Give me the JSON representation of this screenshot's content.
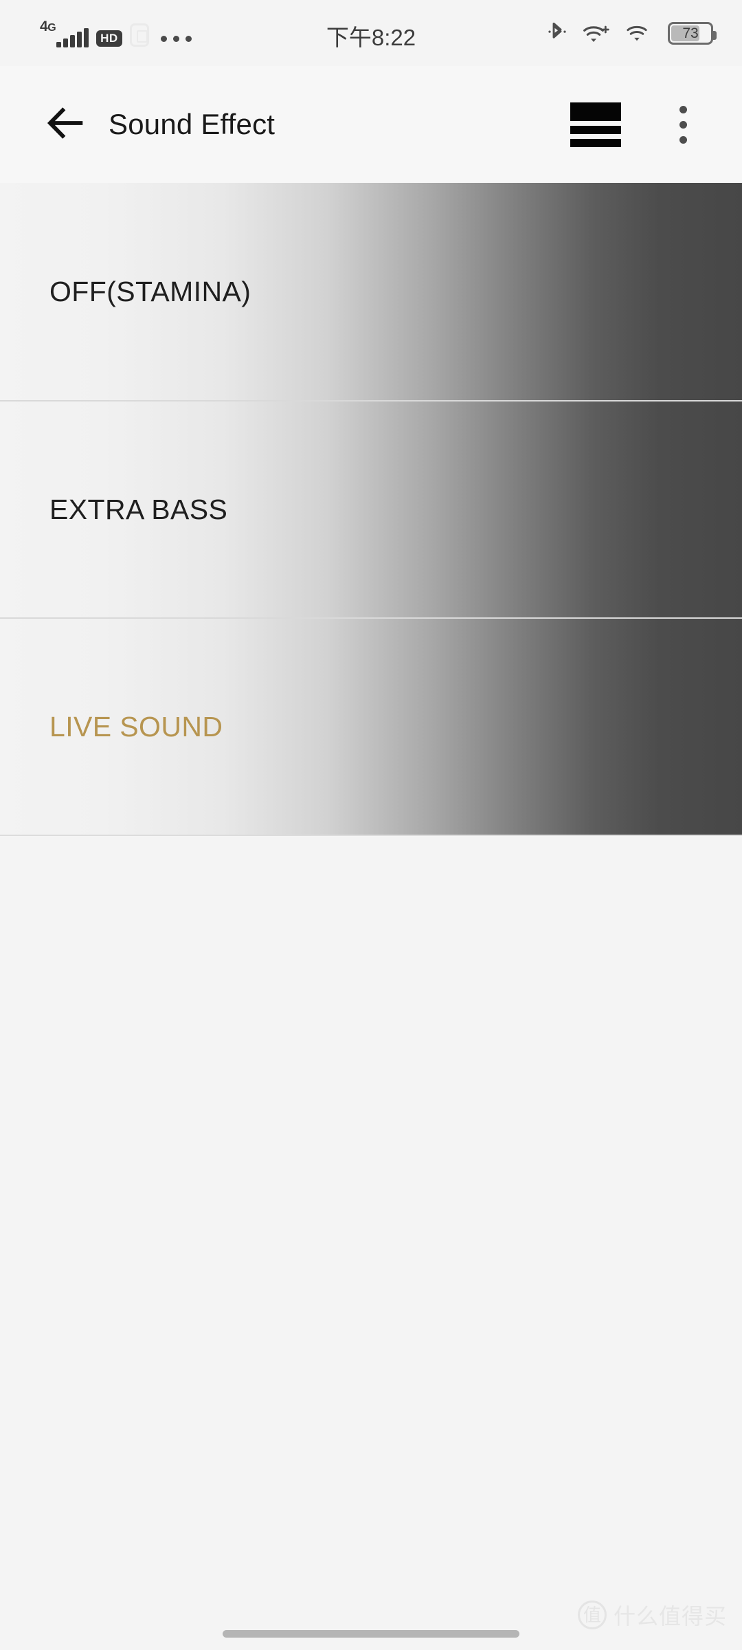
{
  "status_bar": {
    "network_type": "4G",
    "network_type_suffix": "G",
    "network_prefix": "4",
    "hd_badge": "HD",
    "sim_icon": "sim-card-icon",
    "more_icon": "more-horizontal-icon",
    "signal_icon": "signal-bars-icon",
    "clock": "下午8:22",
    "bluetooth_icon": "bluetooth-icon",
    "wifi_plus_icon": "wifi-plus-icon",
    "wifi_icon": "wifi-icon",
    "battery_level": "73",
    "battery_icon": "battery-icon"
  },
  "app_bar": {
    "back_icon": "arrow-left-icon",
    "title": "Sound Effect",
    "list_icon": "equalizer-list-icon",
    "overflow_icon": "more-vertical-icon"
  },
  "effects": {
    "selected_color": "#b79550",
    "items": [
      {
        "label": "OFF(STAMINA)",
        "selected": false
      },
      {
        "label": "EXTRA BASS",
        "selected": false
      },
      {
        "label": "LIVE SOUND",
        "selected": true
      }
    ]
  },
  "watermark": {
    "badge": "值",
    "text": "什么值得买"
  },
  "navigation": {
    "home_indicator": "home-indicator"
  }
}
